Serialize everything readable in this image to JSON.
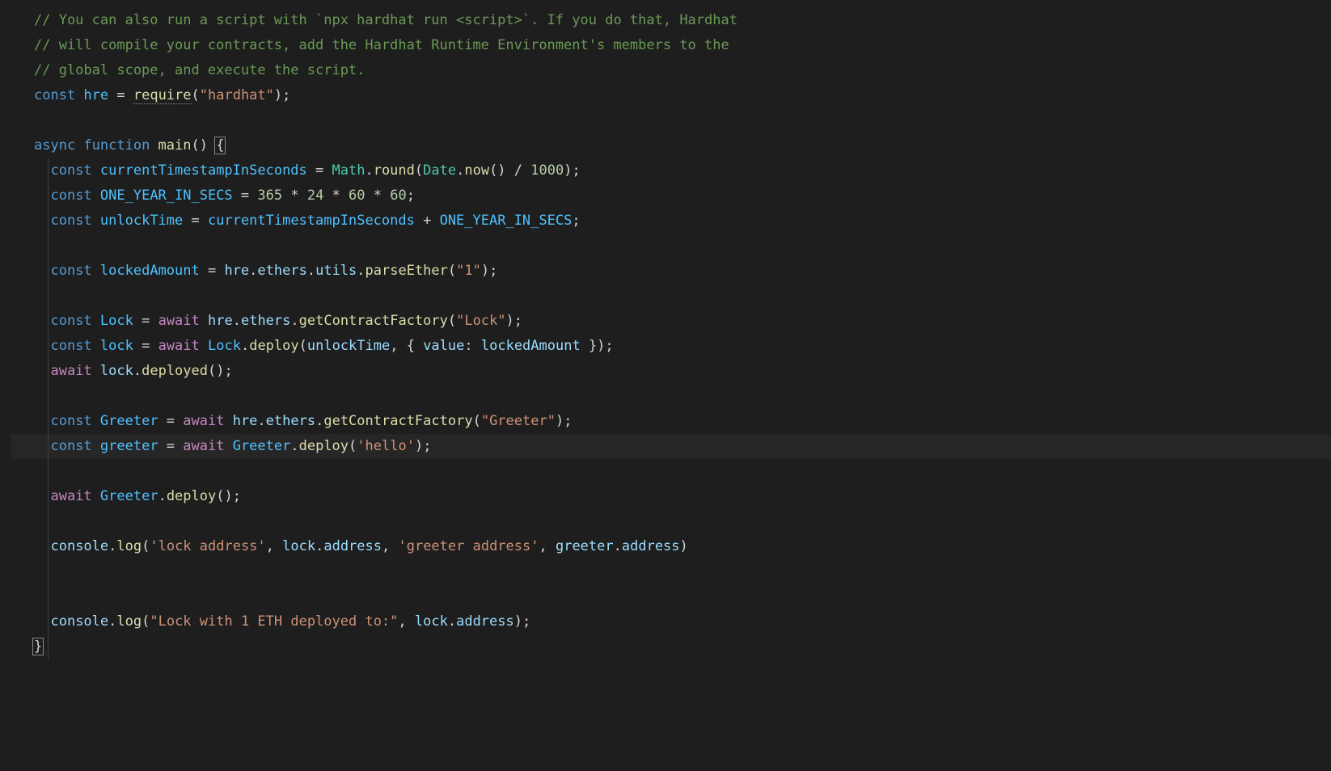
{
  "theme": {
    "background": "#1e1e1e",
    "comment": "#6a9955",
    "keyword": "#569cd6",
    "control": "#c586c0",
    "constant": "#4fc1ff",
    "variable": "#9cdcfe",
    "function": "#dcdcaa",
    "class": "#4ec9b0",
    "string": "#ce9178",
    "number": "#b5cea8",
    "punctuation": "#d4d4d4"
  },
  "code": {
    "lines": [
      {
        "tokens": [
          {
            "t": "// You can also run a script with `npx hardhat run <script>`. If you do that, Hardhat",
            "c": "comment"
          }
        ]
      },
      {
        "tokens": [
          {
            "t": "// will compile your contracts, add the Hardhat Runtime Environment's members to the",
            "c": "comment"
          }
        ]
      },
      {
        "tokens": [
          {
            "t": "// global scope, and execute the script.",
            "c": "comment"
          }
        ]
      },
      {
        "tokens": [
          {
            "t": "const ",
            "c": "keyword"
          },
          {
            "t": "hre",
            "c": "const"
          },
          {
            "t": " = ",
            "c": "op"
          },
          {
            "t": "require",
            "c": "func",
            "u": true
          },
          {
            "t": "(",
            "c": "paren"
          },
          {
            "t": "\"hardhat\"",
            "c": "string"
          },
          {
            "t": ")",
            "c": "paren"
          },
          {
            "t": ";",
            "c": "punct"
          }
        ]
      },
      {
        "tokens": []
      },
      {
        "tokens": [
          {
            "t": "async ",
            "c": "keyword"
          },
          {
            "t": "function ",
            "c": "keyword"
          },
          {
            "t": "main",
            "c": "func"
          },
          {
            "t": "()",
            "c": "paren"
          },
          {
            "t": " ",
            "c": "op"
          },
          {
            "t": "{",
            "c": "brace-match"
          }
        ]
      },
      {
        "indent": 1,
        "tokens": [
          {
            "t": "const ",
            "c": "keyword"
          },
          {
            "t": "currentTimestampInSeconds",
            "c": "const"
          },
          {
            "t": " = ",
            "c": "op"
          },
          {
            "t": "Math",
            "c": "class"
          },
          {
            "t": ".",
            "c": "punct"
          },
          {
            "t": "round",
            "c": "func"
          },
          {
            "t": "(",
            "c": "paren"
          },
          {
            "t": "Date",
            "c": "class"
          },
          {
            "t": ".",
            "c": "punct"
          },
          {
            "t": "now",
            "c": "func"
          },
          {
            "t": "()",
            "c": "paren"
          },
          {
            "t": " / ",
            "c": "op"
          },
          {
            "t": "1000",
            "c": "num"
          },
          {
            "t": ")",
            "c": "paren"
          },
          {
            "t": ";",
            "c": "punct"
          }
        ]
      },
      {
        "indent": 1,
        "tokens": [
          {
            "t": "const ",
            "c": "keyword"
          },
          {
            "t": "ONE_YEAR_IN_SECS",
            "c": "const"
          },
          {
            "t": " = ",
            "c": "op"
          },
          {
            "t": "365",
            "c": "num"
          },
          {
            "t": " * ",
            "c": "op"
          },
          {
            "t": "24",
            "c": "num"
          },
          {
            "t": " * ",
            "c": "op"
          },
          {
            "t": "60",
            "c": "num"
          },
          {
            "t": " * ",
            "c": "op"
          },
          {
            "t": "60",
            "c": "num"
          },
          {
            "t": ";",
            "c": "punct"
          }
        ]
      },
      {
        "indent": 1,
        "tokens": [
          {
            "t": "const ",
            "c": "keyword"
          },
          {
            "t": "unlockTime",
            "c": "const"
          },
          {
            "t": " = ",
            "c": "op"
          },
          {
            "t": "currentTimestampInSeconds",
            "c": "const"
          },
          {
            "t": " + ",
            "c": "op"
          },
          {
            "t": "ONE_YEAR_IN_SECS",
            "c": "const"
          },
          {
            "t": ";",
            "c": "punct"
          }
        ]
      },
      {
        "tokens": []
      },
      {
        "indent": 1,
        "tokens": [
          {
            "t": "const ",
            "c": "keyword"
          },
          {
            "t": "lockedAmount",
            "c": "const"
          },
          {
            "t": " = ",
            "c": "op"
          },
          {
            "t": "hre",
            "c": "var"
          },
          {
            "t": ".",
            "c": "punct"
          },
          {
            "t": "ethers",
            "c": "prop"
          },
          {
            "t": ".",
            "c": "punct"
          },
          {
            "t": "utils",
            "c": "prop"
          },
          {
            "t": ".",
            "c": "punct"
          },
          {
            "t": "parseEther",
            "c": "func"
          },
          {
            "t": "(",
            "c": "paren"
          },
          {
            "t": "\"1\"",
            "c": "string"
          },
          {
            "t": ")",
            "c": "paren"
          },
          {
            "t": ";",
            "c": "punct"
          }
        ]
      },
      {
        "tokens": []
      },
      {
        "indent": 1,
        "tokens": [
          {
            "t": "const ",
            "c": "keyword"
          },
          {
            "t": "Lock",
            "c": "const"
          },
          {
            "t": " = ",
            "c": "op"
          },
          {
            "t": "await ",
            "c": "control"
          },
          {
            "t": "hre",
            "c": "var"
          },
          {
            "t": ".",
            "c": "punct"
          },
          {
            "t": "ethers",
            "c": "prop"
          },
          {
            "t": ".",
            "c": "punct"
          },
          {
            "t": "getContractFactory",
            "c": "func"
          },
          {
            "t": "(",
            "c": "paren"
          },
          {
            "t": "\"Lock\"",
            "c": "string"
          },
          {
            "t": ")",
            "c": "paren"
          },
          {
            "t": ";",
            "c": "punct"
          }
        ]
      },
      {
        "indent": 1,
        "tokens": [
          {
            "t": "const ",
            "c": "keyword"
          },
          {
            "t": "lock",
            "c": "const"
          },
          {
            "t": " = ",
            "c": "op"
          },
          {
            "t": "await ",
            "c": "control"
          },
          {
            "t": "Lock",
            "c": "const"
          },
          {
            "t": ".",
            "c": "punct"
          },
          {
            "t": "deploy",
            "c": "func"
          },
          {
            "t": "(",
            "c": "paren"
          },
          {
            "t": "unlockTime",
            "c": "var"
          },
          {
            "t": ", { ",
            "c": "punct"
          },
          {
            "t": "value",
            "c": "prop"
          },
          {
            "t": ":",
            "c": "punct"
          },
          {
            "t": " ",
            "c": "op"
          },
          {
            "t": "lockedAmount",
            "c": "var"
          },
          {
            "t": " })",
            "c": "punct"
          },
          {
            "t": ";",
            "c": "punct"
          }
        ]
      },
      {
        "indent": 1,
        "tokens": [
          {
            "t": "await ",
            "c": "control"
          },
          {
            "t": "lock",
            "c": "var"
          },
          {
            "t": ".",
            "c": "punct"
          },
          {
            "t": "deployed",
            "c": "func"
          },
          {
            "t": "()",
            "c": "paren"
          },
          {
            "t": ";",
            "c": "punct"
          }
        ]
      },
      {
        "tokens": []
      },
      {
        "indent": 1,
        "tokens": [
          {
            "t": "const ",
            "c": "keyword"
          },
          {
            "t": "Greeter",
            "c": "const"
          },
          {
            "t": " = ",
            "c": "op"
          },
          {
            "t": "await ",
            "c": "control"
          },
          {
            "t": "hre",
            "c": "var"
          },
          {
            "t": ".",
            "c": "punct"
          },
          {
            "t": "ethers",
            "c": "prop"
          },
          {
            "t": ".",
            "c": "punct"
          },
          {
            "t": "getContractFactory",
            "c": "func"
          },
          {
            "t": "(",
            "c": "paren"
          },
          {
            "t": "\"Greeter\"",
            "c": "string"
          },
          {
            "t": ")",
            "c": "paren"
          },
          {
            "t": ";",
            "c": "punct"
          }
        ]
      },
      {
        "indent": 1,
        "highlighted": true,
        "tokens": [
          {
            "t": "const ",
            "c": "keyword"
          },
          {
            "t": "greeter",
            "c": "const"
          },
          {
            "t": " = ",
            "c": "op"
          },
          {
            "t": "await ",
            "c": "control"
          },
          {
            "t": "Greeter",
            "c": "const"
          },
          {
            "t": ".",
            "c": "punct"
          },
          {
            "t": "deploy",
            "c": "func"
          },
          {
            "t": "(",
            "c": "paren"
          },
          {
            "t": "'hello'",
            "c": "string"
          },
          {
            "t": ")",
            "c": "paren"
          },
          {
            "t": ";",
            "c": "punct"
          }
        ]
      },
      {
        "tokens": []
      },
      {
        "indent": 1,
        "tokens": [
          {
            "t": "await ",
            "c": "control"
          },
          {
            "t": "Greeter",
            "c": "const"
          },
          {
            "t": ".",
            "c": "punct"
          },
          {
            "t": "deploy",
            "c": "func"
          },
          {
            "t": "()",
            "c": "paren"
          },
          {
            "t": ";",
            "c": "punct"
          }
        ]
      },
      {
        "tokens": []
      },
      {
        "indent": 1,
        "tokens": [
          {
            "t": "console",
            "c": "var"
          },
          {
            "t": ".",
            "c": "punct"
          },
          {
            "t": "log",
            "c": "func"
          },
          {
            "t": "(",
            "c": "paren"
          },
          {
            "t": "'lock address'",
            "c": "string"
          },
          {
            "t": ", ",
            "c": "punct"
          },
          {
            "t": "lock",
            "c": "var"
          },
          {
            "t": ".",
            "c": "punct"
          },
          {
            "t": "address",
            "c": "prop"
          },
          {
            "t": ", ",
            "c": "punct"
          },
          {
            "t": "'greeter address'",
            "c": "string"
          },
          {
            "t": ", ",
            "c": "punct"
          },
          {
            "t": "greeter",
            "c": "var"
          },
          {
            "t": ".",
            "c": "punct"
          },
          {
            "t": "address",
            "c": "prop"
          },
          {
            "t": ")",
            "c": "paren"
          }
        ]
      },
      {
        "tokens": []
      },
      {
        "tokens": []
      },
      {
        "indent": 1,
        "tokens": [
          {
            "t": "console",
            "c": "var"
          },
          {
            "t": ".",
            "c": "punct"
          },
          {
            "t": "log",
            "c": "func"
          },
          {
            "t": "(",
            "c": "paren"
          },
          {
            "t": "\"Lock with 1 ETH deployed to:\"",
            "c": "string"
          },
          {
            "t": ", ",
            "c": "punct"
          },
          {
            "t": "lock",
            "c": "var"
          },
          {
            "t": ".",
            "c": "punct"
          },
          {
            "t": "address",
            "c": "prop"
          },
          {
            "t": ")",
            "c": "paren"
          },
          {
            "t": ";",
            "c": "punct"
          }
        ]
      },
      {
        "tokens": [
          {
            "t": "}",
            "c": "brace-match"
          }
        ]
      }
    ]
  }
}
